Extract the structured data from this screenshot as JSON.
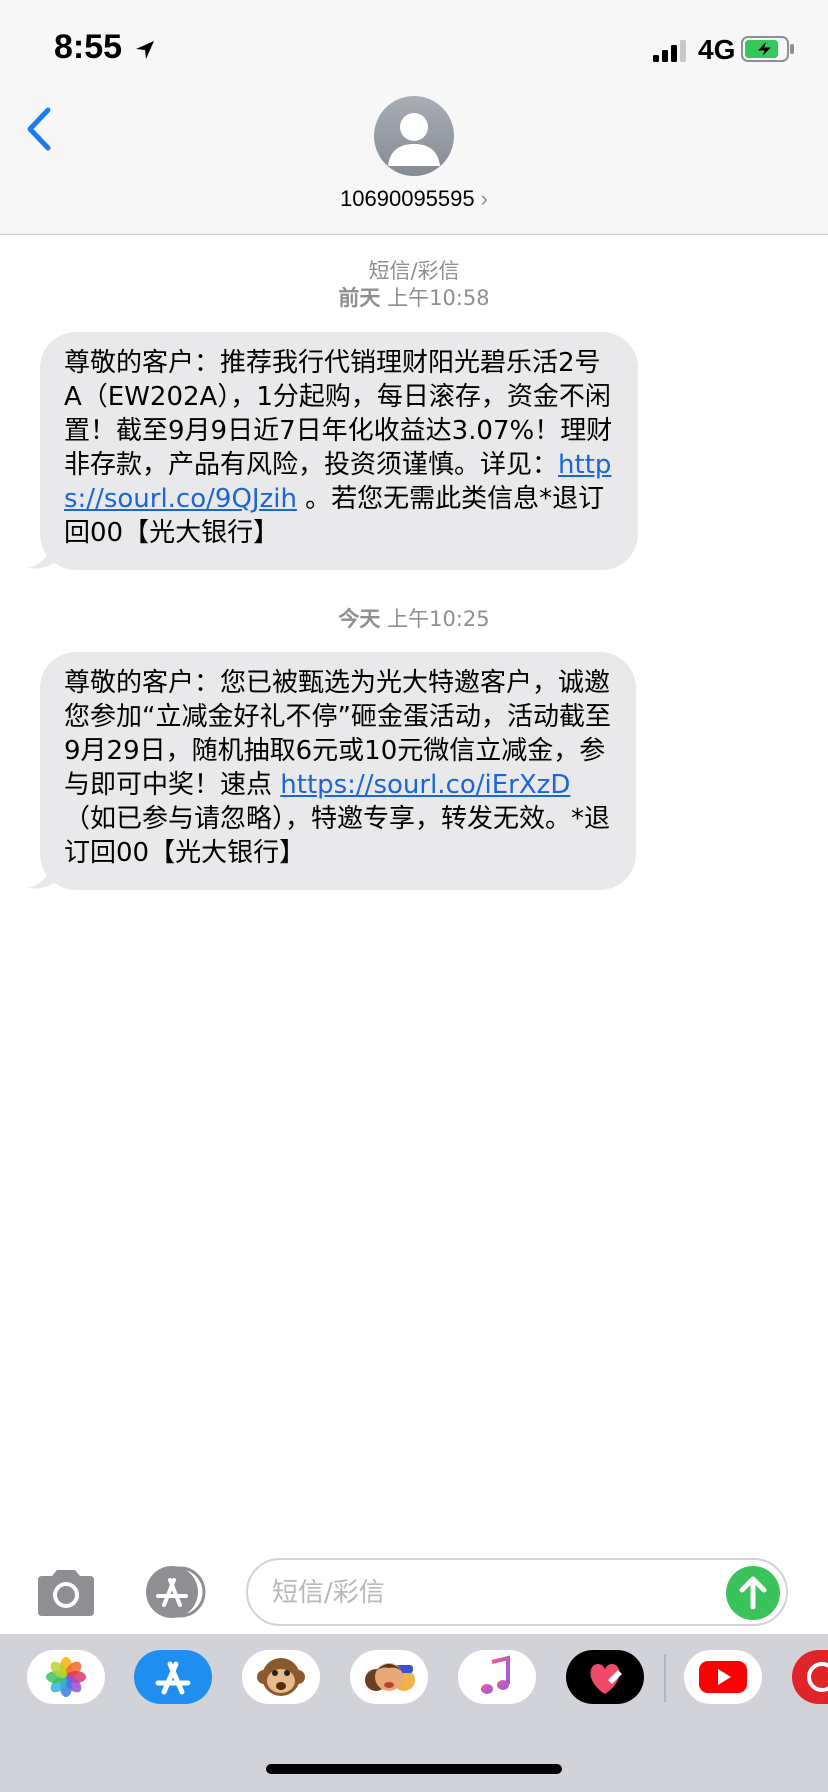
{
  "status_bar": {
    "time": "8:55",
    "network": "4G",
    "icons": [
      "location-arrow-icon",
      "signal-bars-icon",
      "battery-charging-icon"
    ]
  },
  "header": {
    "contact": "10690095595",
    "chevron": "›",
    "icons": [
      "back-chevron-icon",
      "contact-avatar-icon"
    ]
  },
  "messages": [
    {
      "service": "短信/彩信",
      "day": "前天",
      "time": "上午10:58",
      "text_before": "尊敬的客户：推荐我行代销理财阳光碧乐活2号A（EW202A），1分起购，每日滚存，资金不闲置！截至9月9日近7日年化收益达3.07%！理财非存款，产品有风险，投资须谨慎。详见：",
      "link": "https://sourl.co/9QJzih",
      "text_after": " 。若您无需此类信息*退订回00【光大银行】"
    },
    {
      "day": "今天",
      "time": "上午10:25",
      "text_before": "尊敬的客户：您已被甄选为光大特邀客户，诚邀您参加“立减金好礼不停”砸金蛋活动，活动截至9月29日，随机抽取6元或10元微信立减金，参与即可中奖！速点 ",
      "link": "https://sourl.co/iErXzD",
      "text_after": " （如已参与请忽略），特邀专享，转发无效。*退订回00【光大银行】"
    }
  ],
  "input": {
    "placeholder": "短信/彩信",
    "value": "",
    "icons": [
      "camera-icon",
      "app-store-icon",
      "send-arrow-icon"
    ]
  },
  "app_drawer": {
    "icons": [
      "photos-app-icon",
      "app-store-app-icon",
      "animoji-monkey-icon",
      "memoji-icon",
      "music-app-icon",
      "digital-touch-icon",
      "youtube-app-icon",
      "red-app-icon"
    ]
  },
  "colors": {
    "accent": "#1a7cf5",
    "bubble": "#e9e9eb",
    "link": "#1a66d9",
    "send": "#3ac35a",
    "meta": "#8e8e93"
  }
}
